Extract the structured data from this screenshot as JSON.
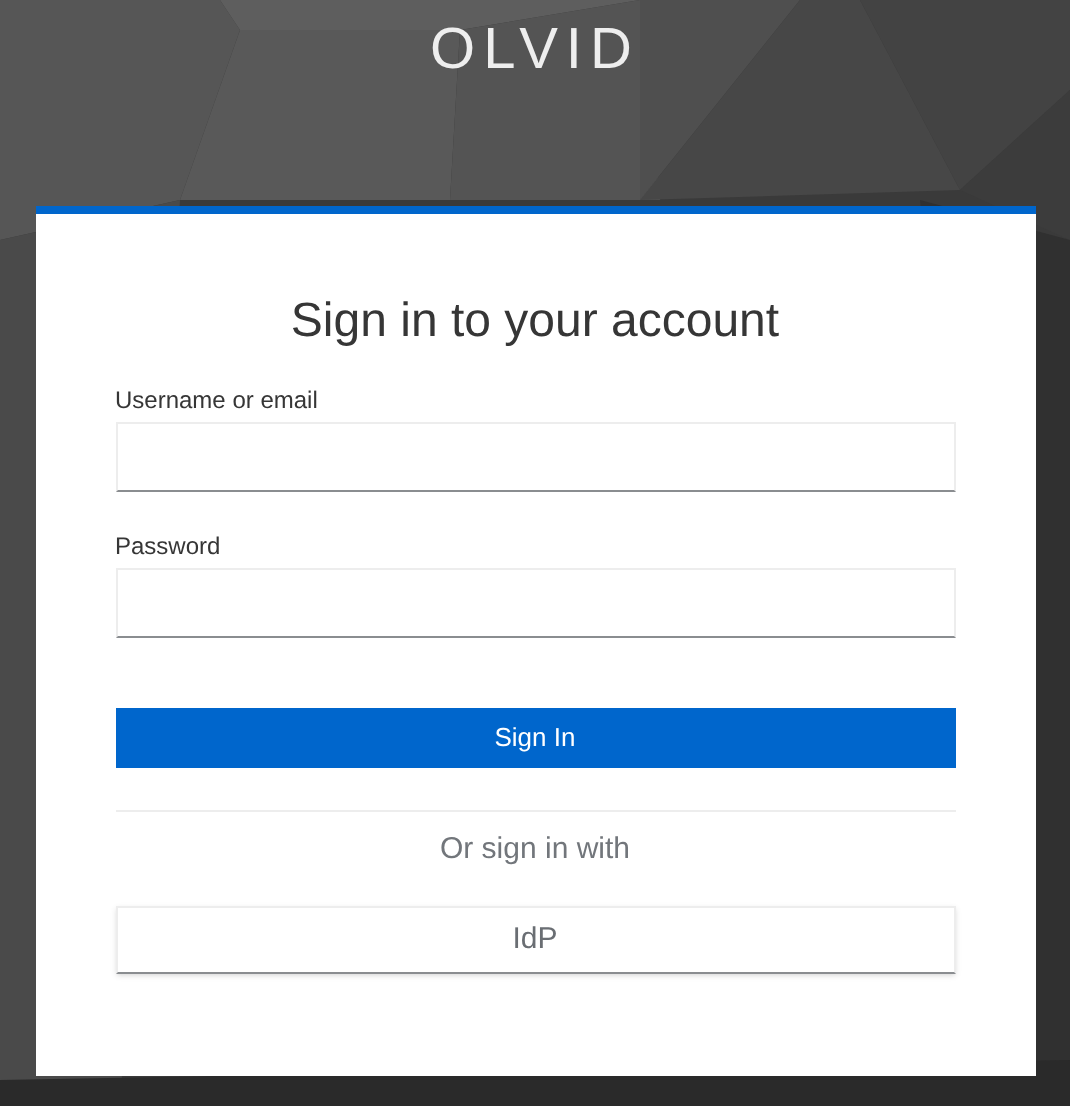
{
  "brand": "OLVID",
  "card": {
    "title": "Sign in to your account",
    "fields": [
      {
        "label": "Username or email"
      },
      {
        "label": "Password"
      }
    ],
    "submit": "Sign In",
    "divider_text": "Or sign in with",
    "providers": [
      "IdP"
    ]
  }
}
